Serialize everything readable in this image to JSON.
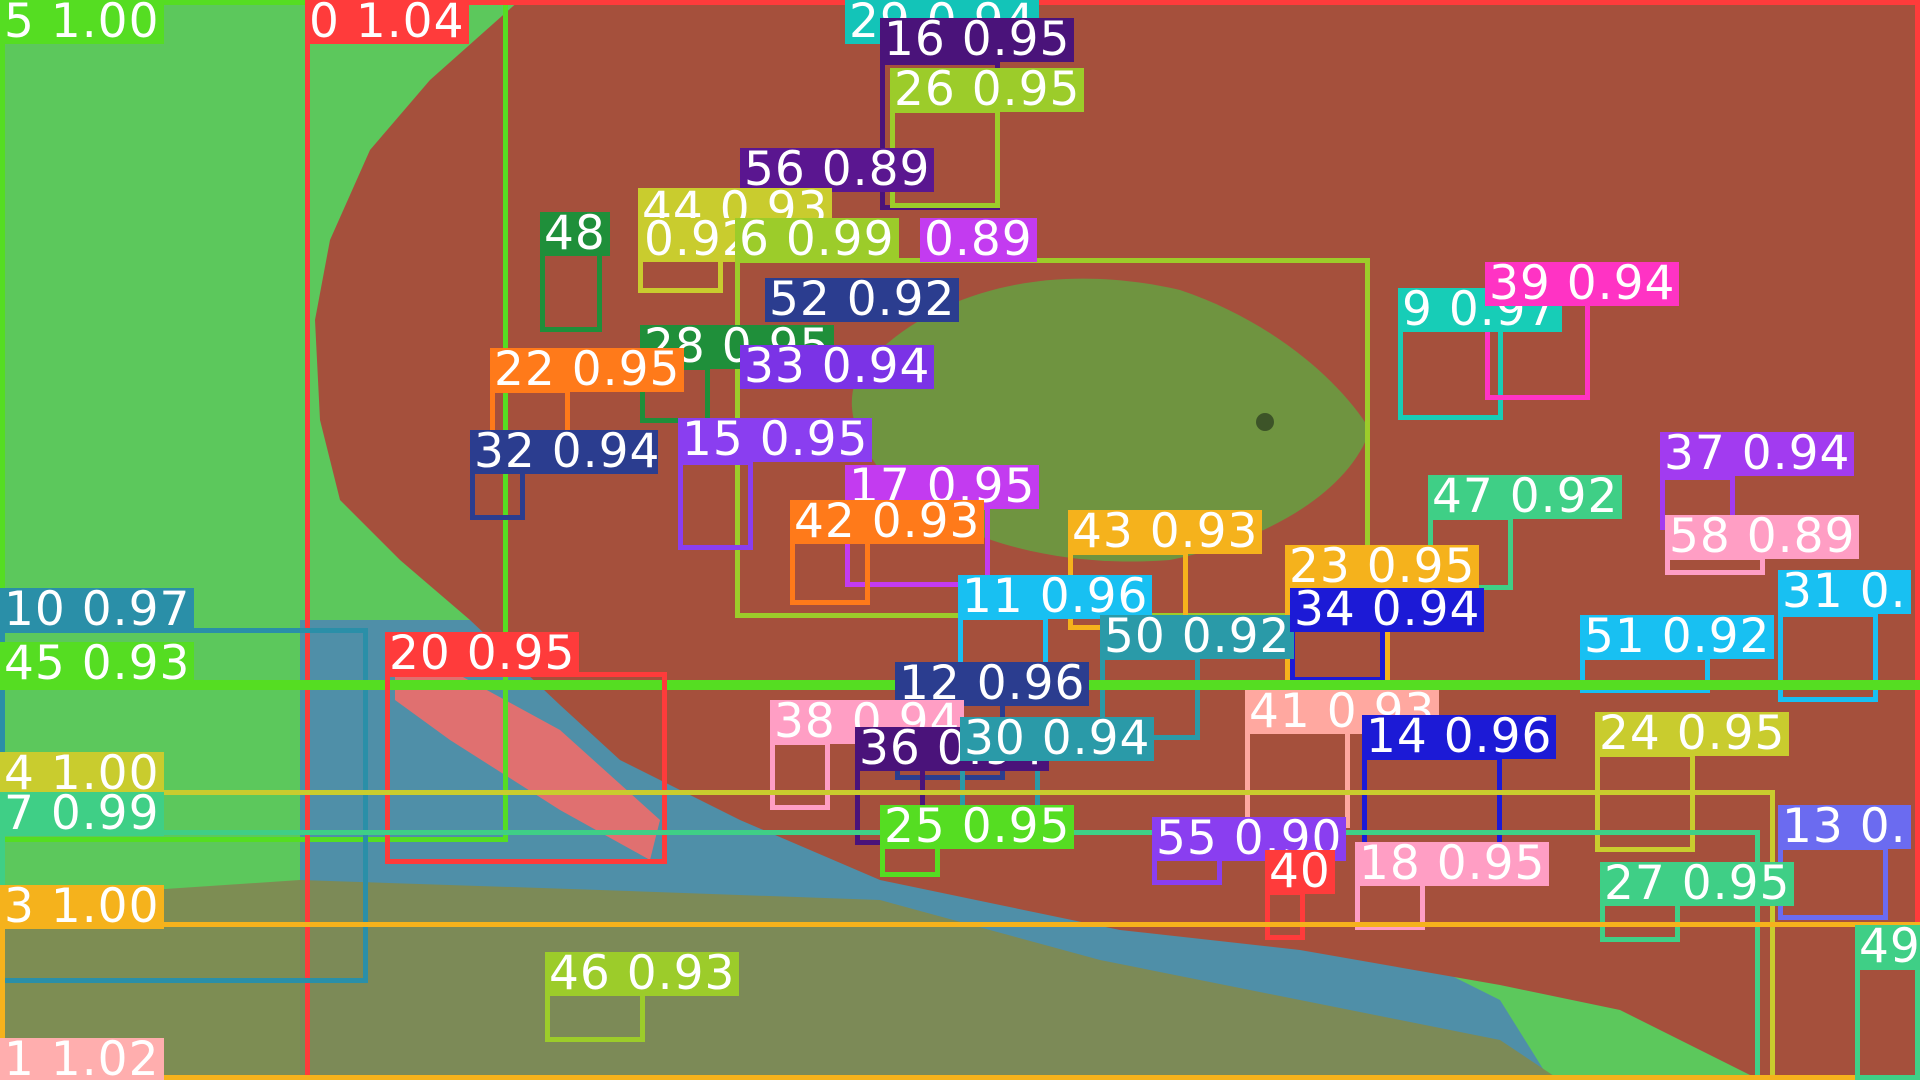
{
  "image": {
    "subject": "fish over reef with segmentation overlay",
    "scene": "underwater-photo-icon"
  },
  "colors": {
    "background_green": "#5cc85c",
    "reef_red": "#a5503c",
    "sand_olive": "#7e8a52",
    "water_blue": "#4f8fa8",
    "fish_green": "#6f9440"
  },
  "detections": [
    {
      "id": "5",
      "label": "5 1.00",
      "color": "#55dd22"
    },
    {
      "id": "0",
      "label": "0 1.04",
      "color": "#ff3b3b"
    },
    {
      "id": "29",
      "label": "29 0.94",
      "color": "#13c4b8"
    },
    {
      "id": "16",
      "label": "16 0.95",
      "color": "#4a137a"
    },
    {
      "id": "26",
      "label": "26 0.95",
      "color": "#9ccc2a"
    },
    {
      "id": "56",
      "label": "56 0.89",
      "color": "#5a1690"
    },
    {
      "id": "44",
      "label": "44 0.93",
      "color": "#c9cc2e"
    },
    {
      "id": "48",
      "label": "48",
      "color": "#1f8f3a"
    },
    {
      "id": "g",
      "label": "0.92",
      "color": "#c9cc2e"
    },
    {
      "id": "6",
      "label": "6 0.99",
      "color": "#9ccc2a"
    },
    {
      "id": "m",
      "label": "0.89",
      "color": "#c33bf0"
    },
    {
      "id": "52",
      "label": "52 0.92",
      "color": "#2b3d8f"
    },
    {
      "id": "28",
      "label": "28 0.95",
      "color": "#1f8f3a"
    },
    {
      "id": "33",
      "label": "33 0.94",
      "color": "#7b33e6"
    },
    {
      "id": "22",
      "label": "22 0.95",
      "color": "#ff7a1a"
    },
    {
      "id": "32",
      "label": "32 0.94",
      "color": "#2b3d8f"
    },
    {
      "id": "15",
      "label": "15 0.95",
      "color": "#8a3ef0"
    },
    {
      "id": "17",
      "label": "17 0.95",
      "color": "#c33bf0"
    },
    {
      "id": "42",
      "label": "42 0.93",
      "color": "#ff7a1a"
    },
    {
      "id": "43",
      "label": "43 0.93",
      "color": "#f5b21c"
    },
    {
      "id": "11",
      "label": "11 0.96",
      "color": "#18c0f2"
    },
    {
      "id": "50",
      "label": "50 0.92",
      "color": "#2a9aa8"
    },
    {
      "id": "9",
      "label": "9 0.97",
      "color": "#17cdb7"
    },
    {
      "id": "39",
      "label": "39 0.94",
      "color": "#ff33c4"
    },
    {
      "id": "37",
      "label": "37 0.94",
      "color": "#a23bf0"
    },
    {
      "id": "47",
      "label": "47 0.92",
      "color": "#3fcf86"
    },
    {
      "id": "58",
      "label": "58 0.89",
      "color": "#ff9ec4"
    },
    {
      "id": "23",
      "label": "23 0.95",
      "color": "#f5b21c"
    },
    {
      "id": "34",
      "label": "34 0.94",
      "color": "#1c1ad6"
    },
    {
      "id": "31",
      "label": "31 0.",
      "color": "#18c0f2"
    },
    {
      "id": "51",
      "label": "51 0.92",
      "color": "#18c0f2"
    },
    {
      "id": "10",
      "label": "10 0.97",
      "color": "#2a8fa8"
    },
    {
      "id": "45",
      "label": "45 0.93",
      "color": "#55dd22"
    },
    {
      "id": "20",
      "label": "20 0.95",
      "color": "#ff3b3b"
    },
    {
      "id": "12",
      "label": "12 0.96",
      "color": "#2b3d8f"
    },
    {
      "id": "38",
      "label": "38 0.94",
      "color": "#ff9ec4"
    },
    {
      "id": "36",
      "label": "36 0.94",
      "color": "#4a137a"
    },
    {
      "id": "30",
      "label": "30 0.94",
      "color": "#2a9aa8"
    },
    {
      "id": "41",
      "label": "41 0.93",
      "color": "#ffa8a0"
    },
    {
      "id": "14",
      "label": "14 0.96",
      "color": "#1c1ad6"
    },
    {
      "id": "24",
      "label": "24 0.95",
      "color": "#c9cc2e"
    },
    {
      "id": "4",
      "label": "4 1.00",
      "color": "#c9cc2e"
    },
    {
      "id": "7",
      "label": "7 0.99",
      "color": "#3fcf86"
    },
    {
      "id": "25",
      "label": "25 0.95",
      "color": "#55dd22"
    },
    {
      "id": "55",
      "label": "55 0.90",
      "color": "#8a3ef0"
    },
    {
      "id": "13",
      "label": "13 0.",
      "color": "#6b6bf0"
    },
    {
      "id": "40",
      "label": "40",
      "color": "#ff3b3b"
    },
    {
      "id": "18",
      "label": "18 0.95",
      "color": "#ff9ec4"
    },
    {
      "id": "27",
      "label": "27 0.95",
      "color": "#3fcf86"
    },
    {
      "id": "3",
      "label": "3 1.00",
      "color": "#f5b21c"
    },
    {
      "id": "49",
      "label": "49",
      "color": "#3fcf86"
    },
    {
      "id": "46",
      "label": "46 0.93",
      "color": "#9ccc2a"
    },
    {
      "id": "1",
      "label": "1 1.02",
      "color": "#ffaeae"
    }
  ]
}
